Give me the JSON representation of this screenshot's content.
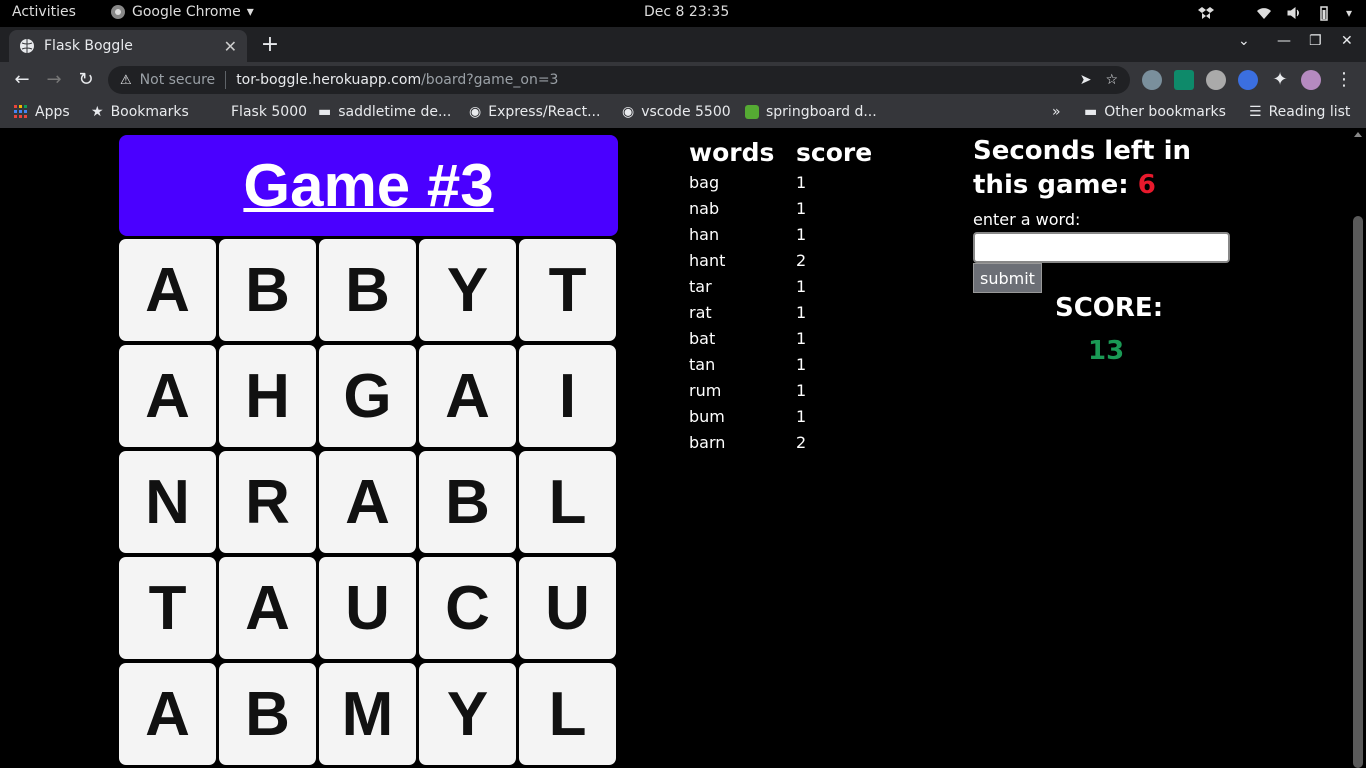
{
  "system": {
    "activities": "Activities",
    "app_name": "Google Chrome",
    "clock": "Dec 8  23:35"
  },
  "browser": {
    "tab_title": "Flask Boggle",
    "security_label": "Not secure",
    "url_host": "tor-boggle.herokuapp.com",
    "url_path": "/board?game_on=3"
  },
  "bookmarks": {
    "apps": "Apps",
    "bookmarks": "Bookmarks",
    "items": [
      "Flask 5000",
      "saddletime de...",
      "Express/React...",
      "vscode 5500",
      "springboard d..."
    ],
    "overflow": "»",
    "other": "Other bookmarks",
    "reading_list": "Reading list"
  },
  "game": {
    "title": "Game #3",
    "board": [
      [
        "A",
        "B",
        "B",
        "Y",
        "T"
      ],
      [
        "A",
        "H",
        "G",
        "A",
        "I"
      ],
      [
        "N",
        "R",
        "A",
        "B",
        "L"
      ],
      [
        "T",
        "A",
        "U",
        "C",
        "U"
      ],
      [
        "A",
        "B",
        "M",
        "Y",
        "L"
      ]
    ],
    "table_headers": {
      "words": "words",
      "score": "score"
    },
    "words": [
      {
        "word": "bag",
        "score": "1"
      },
      {
        "word": "nab",
        "score": "1"
      },
      {
        "word": "han",
        "score": "1"
      },
      {
        "word": "hant",
        "score": "2"
      },
      {
        "word": "tar",
        "score": "1"
      },
      {
        "word": "rat",
        "score": "1"
      },
      {
        "word": "bat",
        "score": "1"
      },
      {
        "word": "tan",
        "score": "1"
      },
      {
        "word": "rum",
        "score": "1"
      },
      {
        "word": "bum",
        "score": "1"
      },
      {
        "word": "barn",
        "score": "2"
      }
    ],
    "timer_text": "Seconds left in this game:",
    "seconds_left": "6",
    "input_label": "enter a word:",
    "input_value": "",
    "submit_label": "submit",
    "score_label": "SCORE:",
    "score_value": "13"
  },
  "colors": {
    "header_bg": "#4a00ff",
    "seconds": "#e8192c",
    "score": "#1a9a55"
  }
}
